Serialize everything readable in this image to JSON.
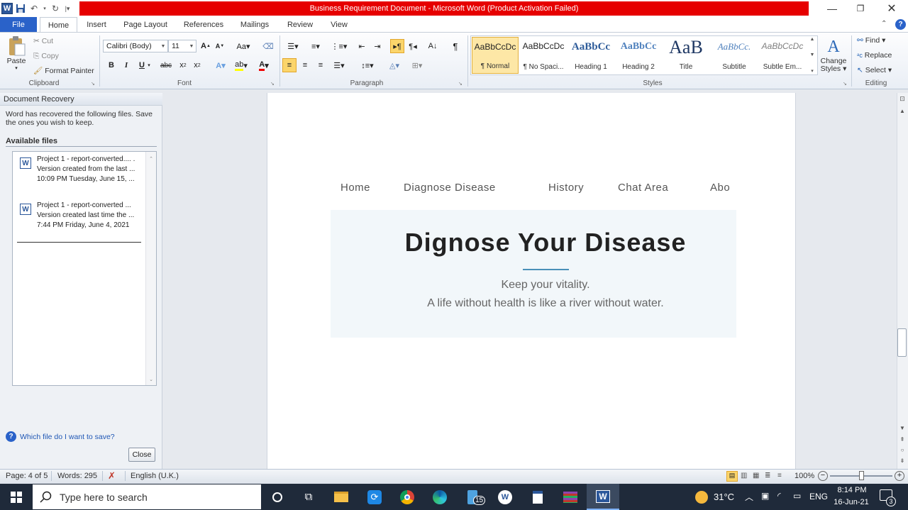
{
  "window": {
    "title": "Business Requirement Document  -  Microsoft Word (Product Activation Failed)"
  },
  "tabs": {
    "file": "File",
    "items": [
      "Home",
      "Insert",
      "Page Layout",
      "References",
      "Mailings",
      "Review",
      "View"
    ],
    "active": "Home"
  },
  "ribbon": {
    "clipboard": {
      "label": "Clipboard",
      "paste": "Paste",
      "cut": "Cut",
      "copy": "Copy",
      "format_painter": "Format Painter"
    },
    "font": {
      "label": "Font",
      "font_name": "Calibri (Body)",
      "font_size": "11"
    },
    "paragraph": {
      "label": "Paragraph"
    },
    "styles": {
      "label": "Styles",
      "items": [
        {
          "sample": "AaBbCcDc",
          "name": "¶ Normal"
        },
        {
          "sample": "AaBbCcDc",
          "name": "¶ No Spaci..."
        },
        {
          "sample": "AaBbCc",
          "name": "Heading 1"
        },
        {
          "sample": "AaBbCc",
          "name": "Heading 2"
        },
        {
          "sample": "AaB",
          "name": "Title"
        },
        {
          "sample": "AaBbCc.",
          "name": "Subtitle"
        },
        {
          "sample": "AaBbCcDc",
          "name": "Subtle Em..."
        }
      ],
      "change_styles_line1": "Change",
      "change_styles_line2": "Styles"
    },
    "editing": {
      "label": "Editing",
      "find": "Find",
      "replace": "Replace",
      "select": "Select"
    }
  },
  "recovery_pane": {
    "title": "Document Recovery",
    "description": "Word has recovered the following files.  Save the ones you wish to keep.",
    "available_files_label": "Available files",
    "files": [
      {
        "name": "Project 1 - report-converted.... .",
        "version": "Version created from the last ...",
        "time": "10:09 PM Tuesday, June 15, ..."
      },
      {
        "name": "Project 1 - report-converted  ...",
        "version": "Version created last time the ...",
        "time": "7:44 PM Friday, June 4, 2021"
      }
    ],
    "help_link": "Which file do I want to save?",
    "close_button": "Close"
  },
  "document": {
    "nav": [
      "Home",
      "Diagnose Disease",
      "History",
      "Chat Area",
      "Abo"
    ],
    "hero_title": "Dignose Your Disease",
    "hero_line1": "Keep your vitality.",
    "hero_line2": "A life without health is like a river without water."
  },
  "statusbar": {
    "page": "Page: 4 of 5",
    "words": "Words: 295",
    "language": "English (U.K.)",
    "zoom": "100%"
  },
  "taskbar": {
    "search_placeholder": "Type here to search",
    "weather": "31°C",
    "language": "ENG",
    "time": "8:14 PM",
    "date": "16-Jun-21",
    "notification_count": "3",
    "badge_count": "15"
  },
  "colors": {
    "title_bar_red": "#e60000",
    "file_tab_blue": "#2a62c9",
    "accent_line": "#4a90b8",
    "taskbar": "#1f2a3a"
  }
}
